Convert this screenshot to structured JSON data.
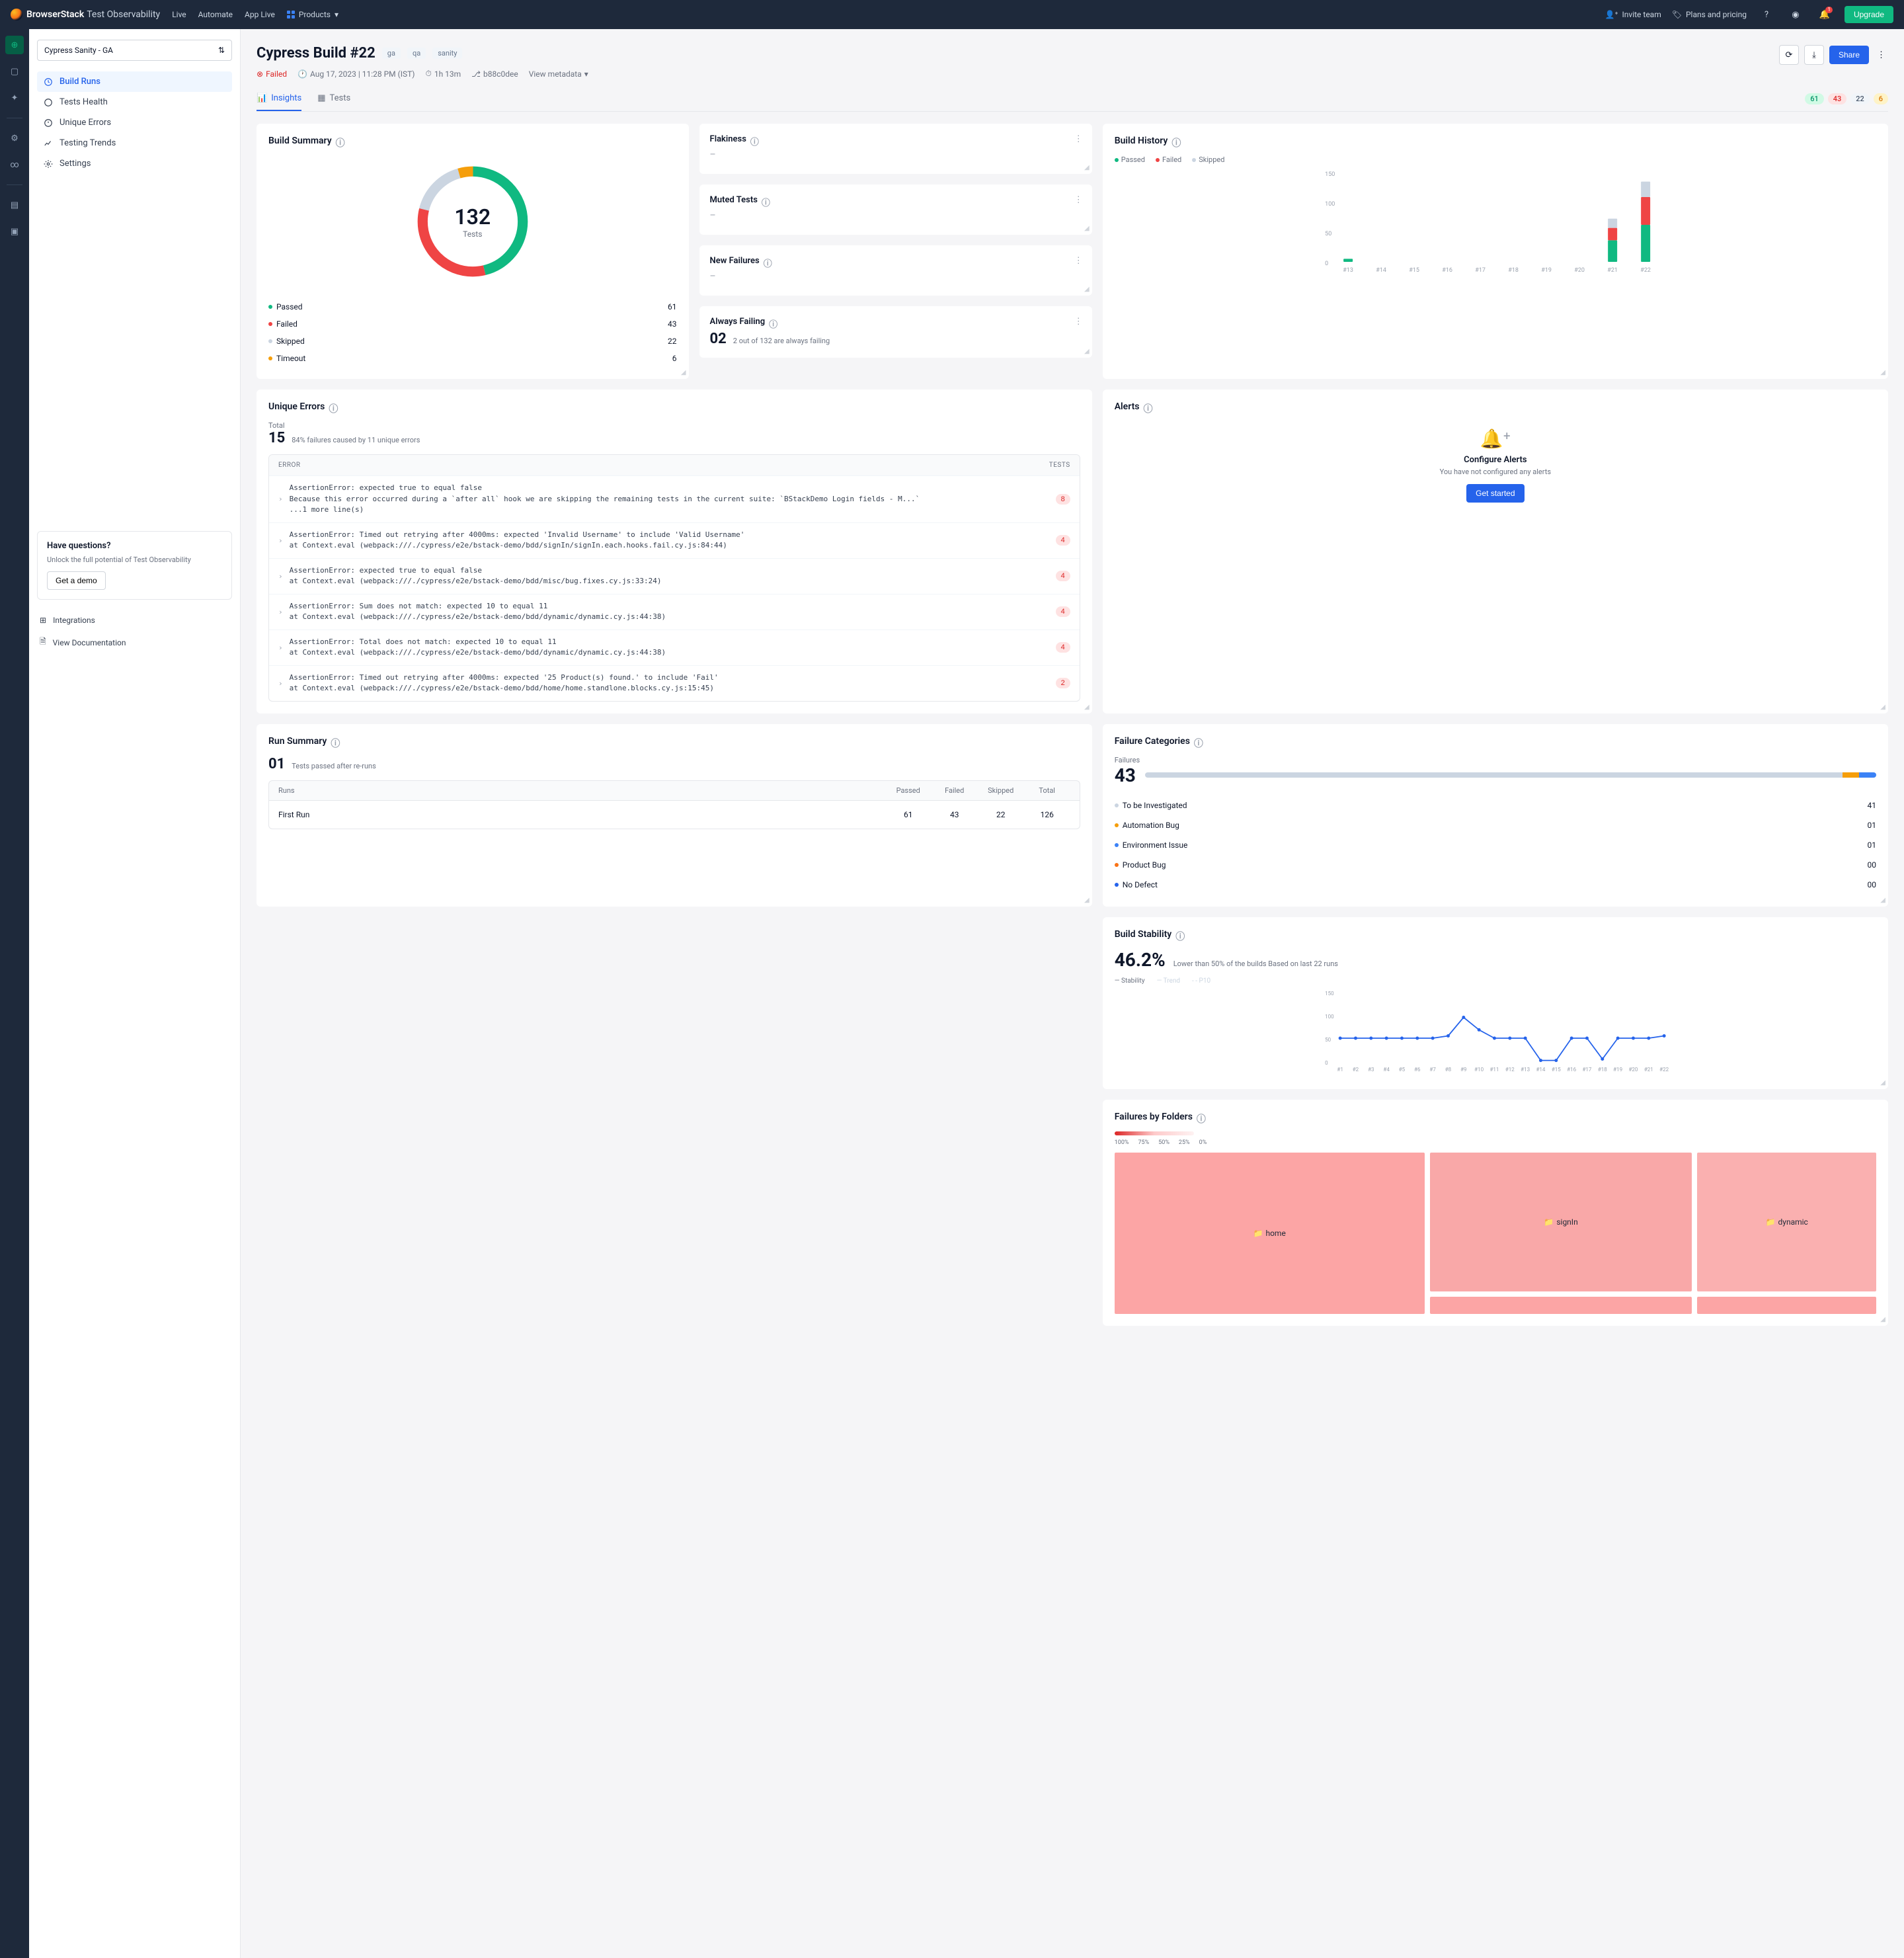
{
  "topbar": {
    "brand": "BrowserStack",
    "product": "Test Observability",
    "nav": [
      "Live",
      "Automate",
      "App Live"
    ],
    "products": "Products",
    "invite": "Invite team",
    "plans": "Plans and pricing",
    "notif": "1",
    "upgrade": "Upgrade"
  },
  "sidebar": {
    "project": "Cypress Sanity - GA",
    "items": [
      "Build Runs",
      "Tests Health",
      "Unique Errors",
      "Testing Trends",
      "Settings"
    ],
    "promo_title": "Have questions?",
    "promo_text": "Unlock the full potential of Test Observability",
    "demo": "Get a demo",
    "integrations": "Integrations",
    "docs": "View Documentation"
  },
  "header": {
    "title": "Cypress Build #22",
    "tags": [
      "ga",
      "qa",
      "sanity"
    ],
    "status": "Failed",
    "date": "Aug 17, 2023 | 11:28 PM (IST)",
    "duration": "1h 13m",
    "commit": "b88c0dee",
    "view_meta": "View metadata",
    "share": "Share"
  },
  "tabs": {
    "insights": "Insights",
    "tests": "Tests"
  },
  "badges": {
    "passed": "61",
    "failed": "43",
    "skipped": "22",
    "timeout": "6"
  },
  "build_summary": {
    "title": "Build Summary",
    "total": "132",
    "total_label": "Tests",
    "rows": [
      {
        "label": "Passed",
        "value": "61",
        "color": "#10b981"
      },
      {
        "label": "Failed",
        "value": "43",
        "color": "#ef4444"
      },
      {
        "label": "Skipped",
        "value": "22",
        "color": "#cbd5e1"
      },
      {
        "label": "Timeout",
        "value": "6",
        "color": "#f59e0b"
      }
    ]
  },
  "mini": {
    "flakiness": "Flakiness",
    "muted": "Muted Tests",
    "newf": "New Failures",
    "always": "Always Failing",
    "always_num": "02",
    "always_text": "2 out of 132 are always failing"
  },
  "build_history": {
    "title": "Build History",
    "legend": [
      "Passed",
      "Failed",
      "Skipped"
    ],
    "yticks": [
      "150",
      "100",
      "50",
      "0"
    ]
  },
  "chart_data": {
    "build_history": {
      "type": "bar",
      "categories": [
        "#13",
        "#14",
        "#15",
        "#16",
        "#17",
        "#18",
        "#19",
        "#20",
        "#21",
        "#22"
      ],
      "series": [
        {
          "name": "Passed",
          "values": [
            5,
            0,
            0,
            0,
            0,
            0,
            0,
            0,
            35,
            60
          ],
          "color": "#10b981"
        },
        {
          "name": "Failed",
          "values": [
            0,
            0,
            0,
            0,
            0,
            0,
            0,
            0,
            20,
            45
          ],
          "color": "#ef4444"
        },
        {
          "name": "Skipped",
          "values": [
            0,
            0,
            0,
            0,
            0,
            0,
            0,
            0,
            15,
            25
          ],
          "color": "#cbd5e1"
        }
      ],
      "ylim": [
        0,
        150
      ],
      "stacked": true
    },
    "build_stability": {
      "type": "line",
      "x": [
        "#1",
        "#2",
        "#3",
        "#4",
        "#5",
        "#6",
        "#7",
        "#8",
        "#9",
        "#10",
        "#11",
        "#12",
        "#13",
        "#14",
        "#15",
        "#16",
        "#17",
        "#18",
        "#19",
        "#20",
        "#21",
        "#22"
      ],
      "series": [
        {
          "name": "Stability",
          "values": [
            50,
            50,
            50,
            50,
            50,
            50,
            50,
            55,
            95,
            68,
            50,
            50,
            50,
            2,
            2,
            50,
            50,
            5,
            50,
            50,
            50,
            55
          ],
          "color": "#2563eb"
        }
      ],
      "ylim": [
        0,
        150
      ],
      "ylabel": "",
      "trend_shown": true,
      "p10_shown": true
    },
    "build_summary_donut": {
      "type": "pie",
      "categories": [
        "Passed",
        "Failed",
        "Skipped",
        "Timeout"
      ],
      "values": [
        61,
        43,
        22,
        6
      ],
      "colors": [
        "#10b981",
        "#ef4444",
        "#cbd5e1",
        "#f59e0b"
      ]
    }
  },
  "unique_errors": {
    "title": "Unique Errors",
    "total_label": "Total",
    "total": "15",
    "sub": "84% failures caused by 11 unique errors",
    "col_error": "ERROR",
    "col_tests": "TESTS",
    "rows": [
      {
        "text": "AssertionError: expected true to equal false\nBecause this error occurred during a `after all` hook we are skipping the remaining tests in the current suite: `BStackDemo Login fields - M...`\n...1 more line(s)",
        "count": "8"
      },
      {
        "text": "AssertionError: Timed out retrying after 4000ms: expected 'Invalid Username' to include 'Valid Username'\nat Context.eval (webpack:///./cypress/e2e/bstack-demo/bdd/signIn/signIn.each.hooks.fail.cy.js:84:44)",
        "count": "4"
      },
      {
        "text": "AssertionError: expected true to equal false\nat Context.eval (webpack:///./cypress/e2e/bstack-demo/bdd/misc/bug.fixes.cy.js:33:24)",
        "count": "4"
      },
      {
        "text": "AssertionError: Sum does not match: expected 10 to equal 11\nat Context.eval (webpack:///./cypress/e2e/bstack-demo/bdd/dynamic/dynamic.cy.js:44:38)",
        "count": "4"
      },
      {
        "text": "AssertionError: Total does not match: expected 10 to equal 11\nat Context.eval (webpack:///./cypress/e2e/bstack-demo/bdd/dynamic/dynamic.cy.js:44:38)",
        "count": "4"
      },
      {
        "text": "AssertionError: Timed out retrying after 4000ms: expected '25 Product(s) found.' to include 'Fail'\nat Context.eval (webpack:///./cypress/e2e/bstack-demo/bdd/home/home.standlone.blocks.cy.js:15:45)",
        "count": "2"
      }
    ]
  },
  "alerts": {
    "title": "Alerts",
    "empty_title": "Configure Alerts",
    "empty_sub": "You have not configured any alerts",
    "cta": "Get started"
  },
  "failure_cats": {
    "title": "Failure Categories",
    "label": "Failures",
    "total": "43",
    "rows": [
      {
        "label": "To be Investigated",
        "value": "41",
        "color": "#cbd5e1"
      },
      {
        "label": "Automation Bug",
        "value": "01",
        "color": "#f59e0b"
      },
      {
        "label": "Environment Issue",
        "value": "01",
        "color": "#3b82f6"
      },
      {
        "label": "Product Bug",
        "value": "00",
        "color": "#f97316"
      },
      {
        "label": "No Defect",
        "value": "00",
        "color": "#2563eb"
      }
    ]
  },
  "stability": {
    "title": "Build Stability",
    "pct": "46.2%",
    "sub": "Lower than 50% of the builds Based on last 22 runs",
    "legend": [
      "Stability",
      "Trend",
      "P10"
    ]
  },
  "run_summary": {
    "title": "Run Summary",
    "num": "01",
    "sub": "Tests passed after re-runs",
    "cols": [
      "Runs",
      "Passed",
      "Failed",
      "Skipped",
      "Total"
    ],
    "row": {
      "name": "First Run",
      "passed": "61",
      "failed": "43",
      "skipped": "22",
      "total": "126"
    }
  },
  "folders": {
    "title": "Failures by Folders",
    "scale": [
      "100%",
      "75%",
      "50%",
      "25%",
      "0%"
    ],
    "boxes": [
      "home",
      "signIn",
      "dynamic"
    ]
  }
}
